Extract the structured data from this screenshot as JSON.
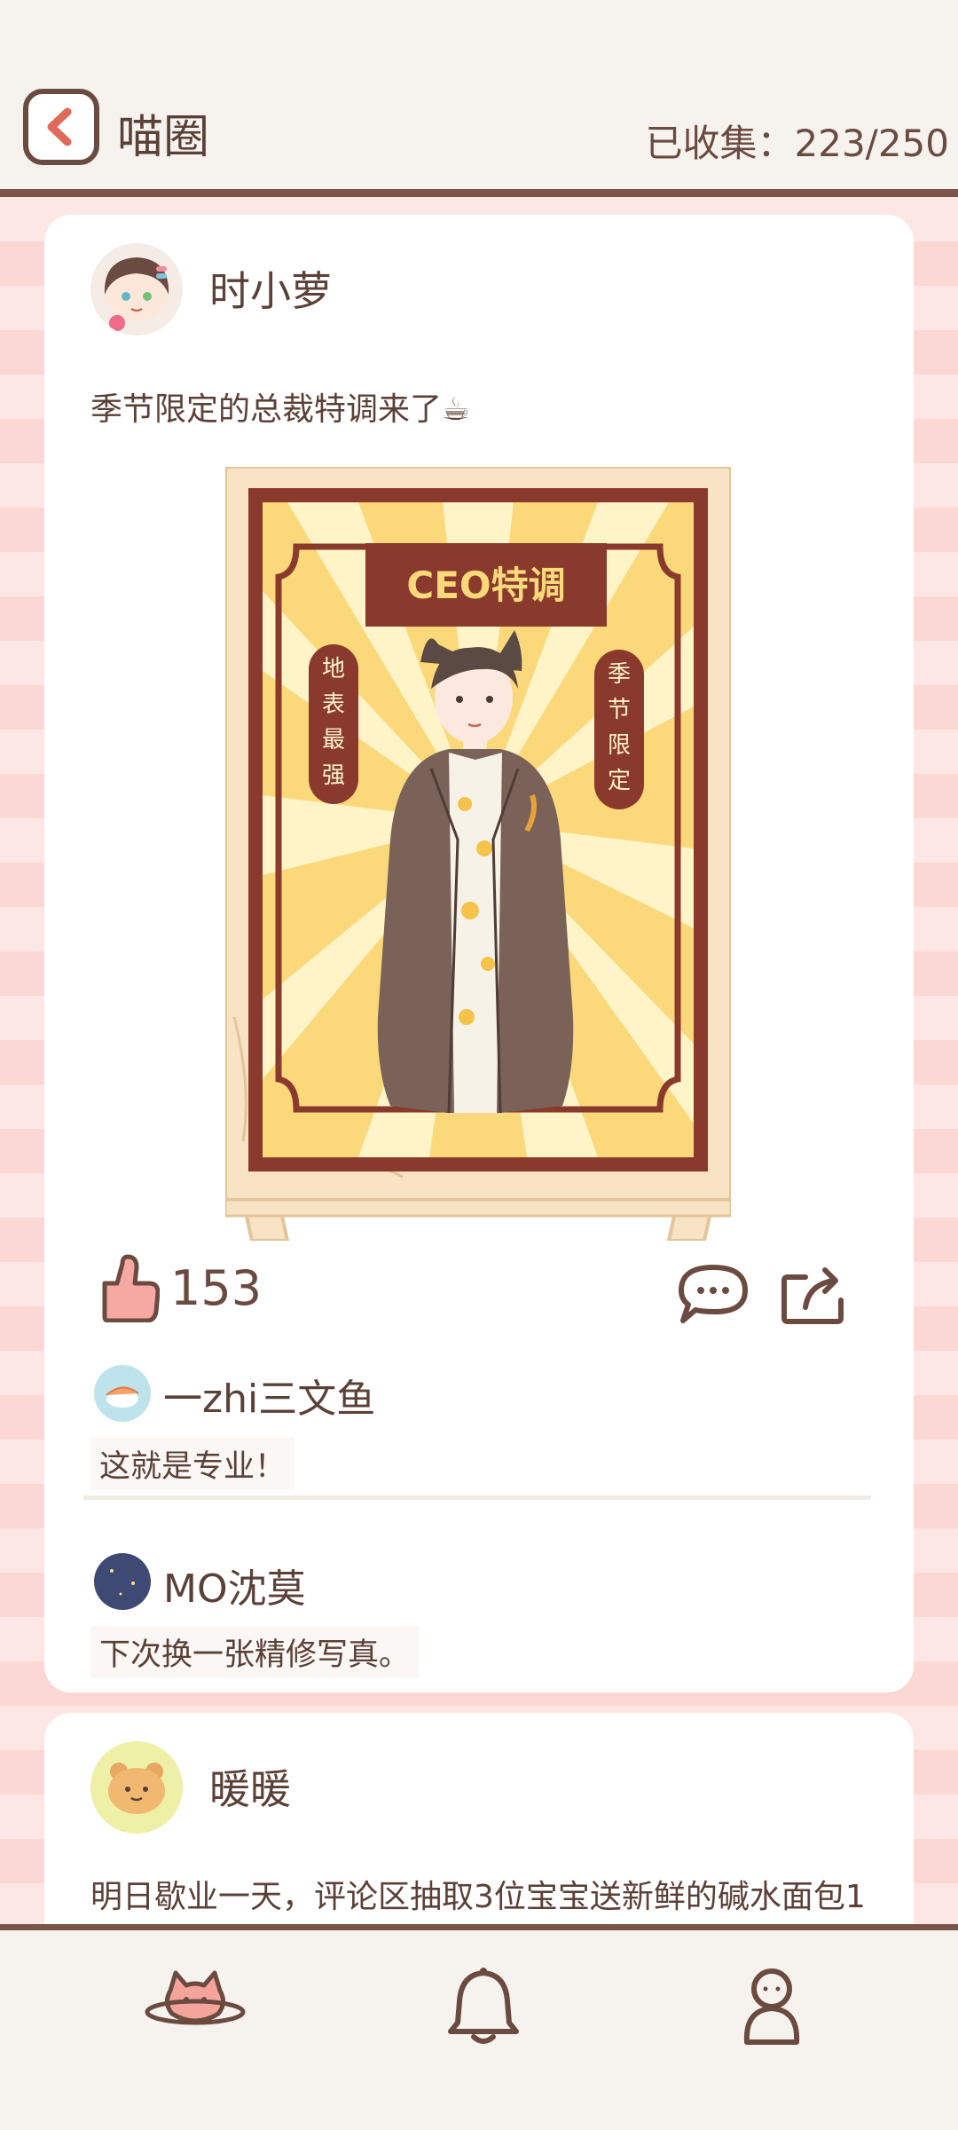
{
  "header": {
    "title": "喵圈",
    "collected": "已收集：223/250"
  },
  "posts": [
    {
      "author": "时小萝",
      "text": "季节限定的总裁特调来了☕",
      "poster": {
        "banner": "CEO特调",
        "left_tag": "地表最强",
        "right_tag": "季节限定"
      },
      "likes": "153",
      "comments": [
        {
          "name": "一zhi三文鱼",
          "text": "这就是专业！"
        },
        {
          "name": "MO沈莫",
          "text": "下次换一张精修写真。"
        }
      ]
    },
    {
      "author": "暖暖",
      "text": "明日歇业一天，评论区抽取3位宝宝送新鲜的碱水面包1"
    }
  ],
  "tabbar": {
    "items": [
      "planet-cat-icon",
      "bell-icon",
      "profile-icon"
    ]
  },
  "colors": {
    "brown": "#6b4a3f",
    "pink_bg": "#fbd8d4",
    "card": "#ffffff",
    "poster_red": "#8a3a2c",
    "poster_yellow": "#fbd87a"
  }
}
